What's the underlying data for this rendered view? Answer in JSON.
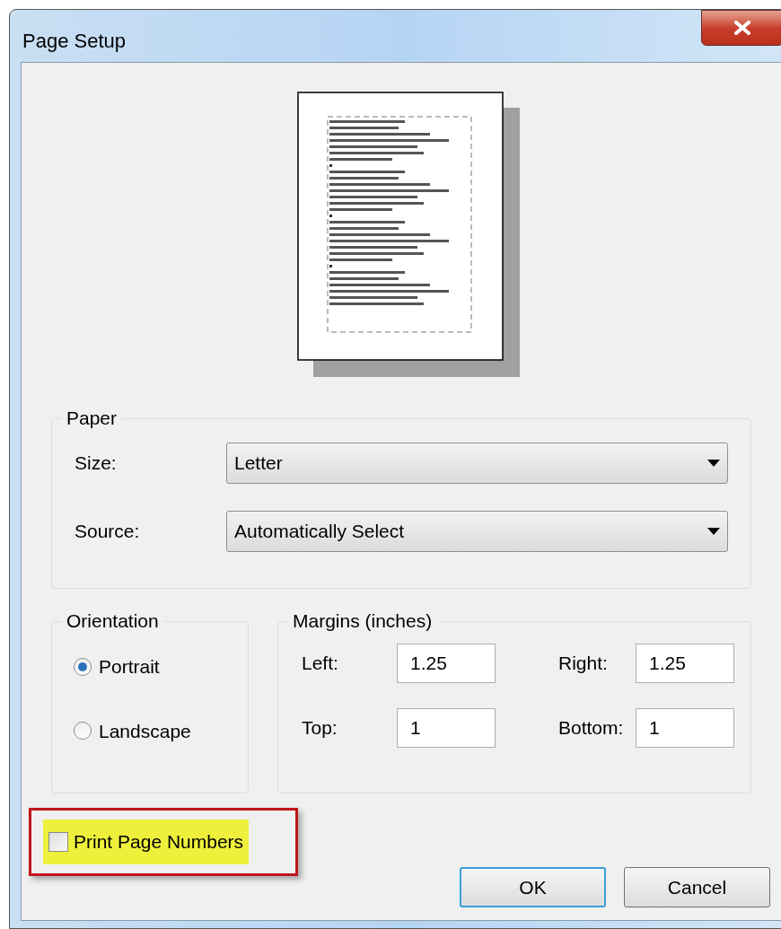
{
  "window": {
    "title": "Page Setup"
  },
  "paper": {
    "title": "Paper",
    "fields": [
      {
        "label": "Size:",
        "value": "Letter"
      },
      {
        "label": "Source:",
        "value": "Automatically Select"
      }
    ]
  },
  "orientation": {
    "title": "Orientation",
    "options": [
      {
        "label": "Portrait",
        "selected": true
      },
      {
        "label": "Landscape",
        "selected": false
      }
    ]
  },
  "margins": {
    "title": "Margins (inches)",
    "fields": [
      {
        "label": "Left:",
        "value": "1.25"
      },
      {
        "label": "Right:",
        "value": "1.25"
      },
      {
        "label": "Top:",
        "value": "1"
      },
      {
        "label": "Bottom:",
        "value": "1"
      }
    ]
  },
  "print_page_numbers": {
    "label": "Print Page Numbers",
    "checked": false,
    "highlighted": true
  },
  "buttons": [
    {
      "label": "OK",
      "default": true
    },
    {
      "label": "Cancel",
      "default": false
    }
  ]
}
